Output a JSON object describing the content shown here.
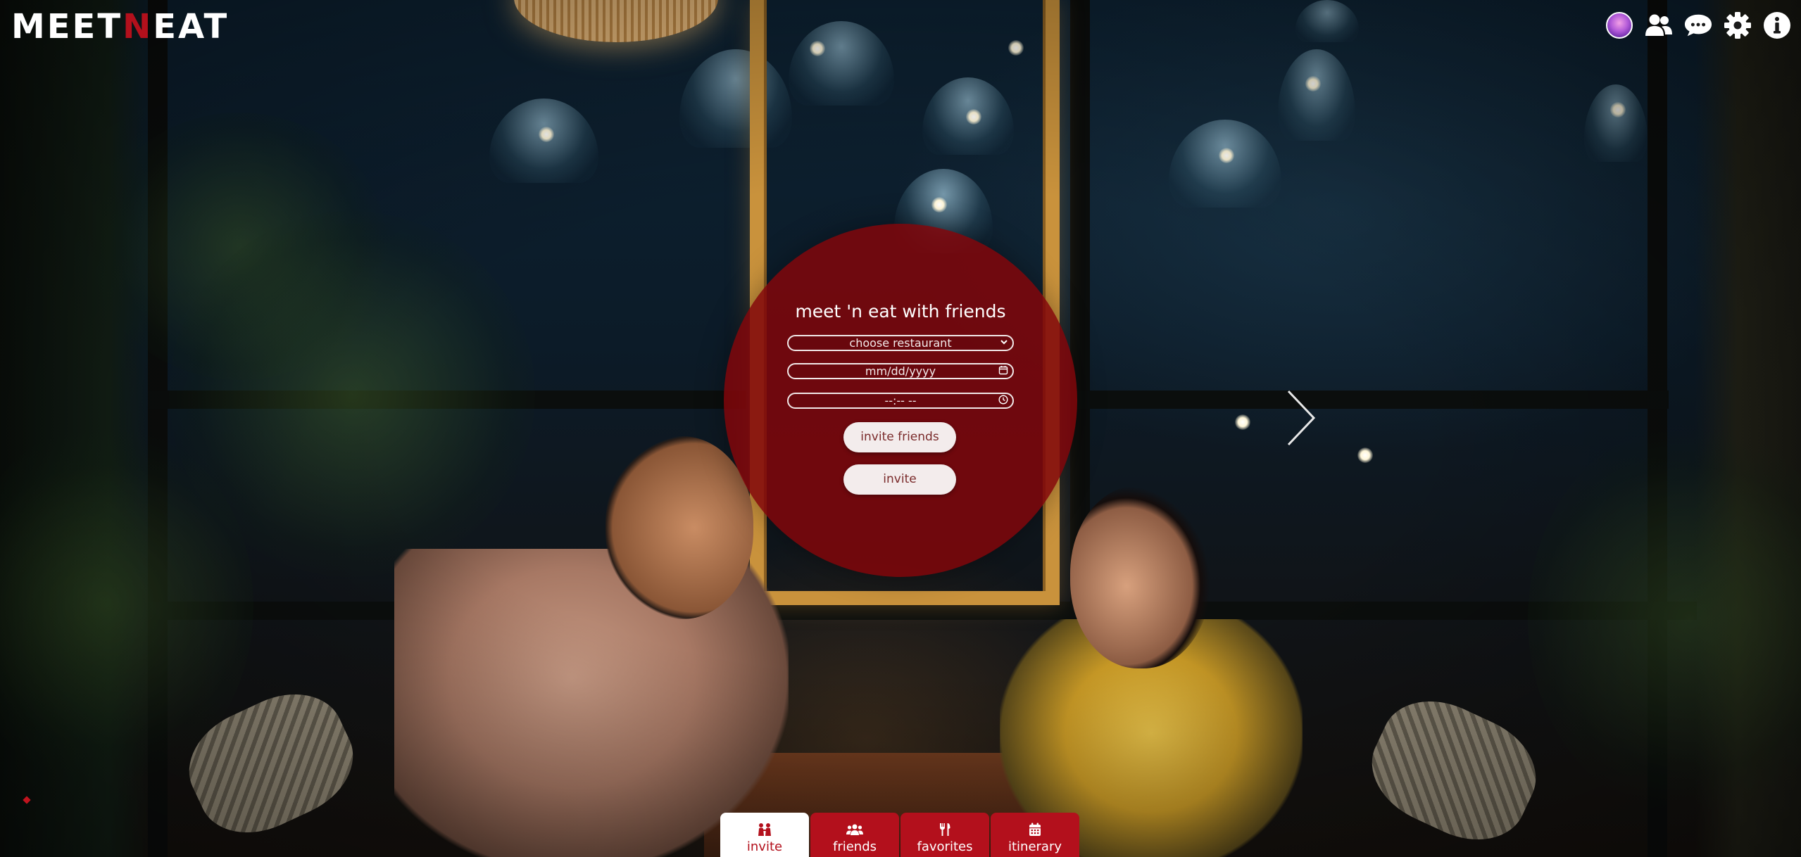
{
  "brand": {
    "logo_part1": "MEET",
    "logo_accent": "N",
    "logo_part2": "EAT",
    "accent_color": "#b3101c"
  },
  "header": {
    "icons": [
      "avatar",
      "friends-icon",
      "chat-icon",
      "gear-icon",
      "info-icon"
    ]
  },
  "form": {
    "title": "meet 'n eat with friends",
    "restaurant_select": "choose restaurant",
    "date_placeholder": "mm/dd/yyyy",
    "time_placeholder": "--:-- --",
    "invite_friends_button": "invite friends",
    "invite_button": "invite"
  },
  "tabs": [
    {
      "label": "invite",
      "icon": "people-pair-icon",
      "active": true
    },
    {
      "label": "friends",
      "icon": "group-icon",
      "active": false
    },
    {
      "label": "favorites",
      "icon": "utensils-icon",
      "active": false
    },
    {
      "label": "itinerary",
      "icon": "calendar-icon",
      "active": false
    }
  ]
}
